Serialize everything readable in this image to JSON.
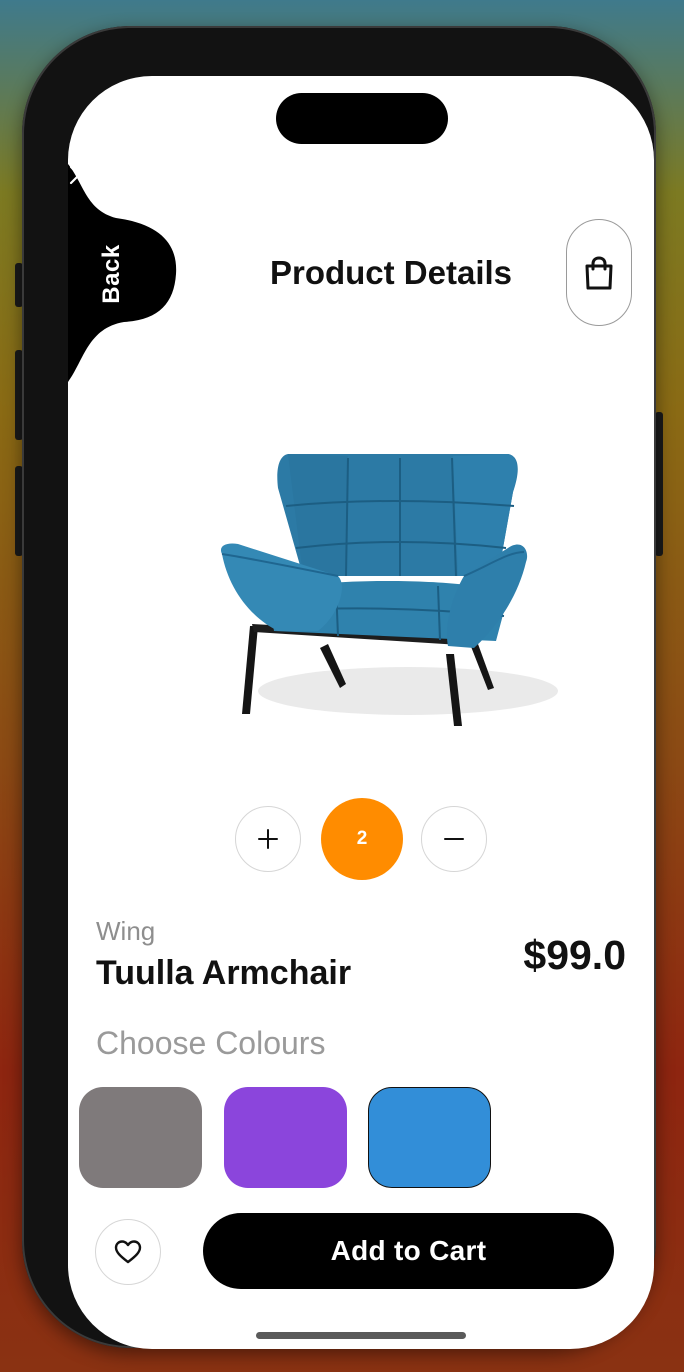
{
  "header": {
    "back_label": "Back",
    "title": "Product Details"
  },
  "product": {
    "brand": "Wing",
    "name": "Tuulla Armchair",
    "price": "$99.0",
    "quantity": "2",
    "image_description": "blue-armchair"
  },
  "colours": {
    "heading": "Choose Colours",
    "options": [
      {
        "name": "grey",
        "hex": "#7f7a7b"
      },
      {
        "name": "purple",
        "hex": "#8b45dc"
      },
      {
        "name": "blue",
        "hex": "#328ed8"
      }
    ]
  },
  "actions": {
    "add_to_cart": "Add to Cart"
  },
  "theme": {
    "accent": "#ff8c00",
    "primary": "#000000",
    "chair_color": "#2f7fa8"
  }
}
